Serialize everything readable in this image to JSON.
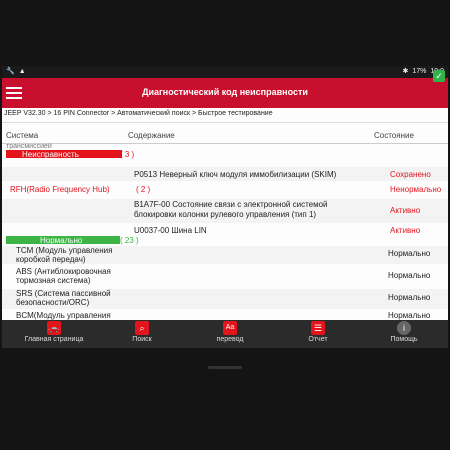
{
  "status_bar": {
    "bt": "✱",
    "battery": "17%",
    "time": "19:0"
  },
  "app": {
    "title": "Диагностический код неисправности"
  },
  "breadcrumb": "JEEP V32.30 > 16 PIN Connector > Автоматический поиск > Быстрое тестирование",
  "columns": {
    "system": "Система",
    "content": "Содержание",
    "status": "Состояние"
  },
  "cut_row": "трансмиссией",
  "fault_section": {
    "label": "Неисправность",
    "count": "( 3 )"
  },
  "faults": [
    {
      "content": "P0513 Неверный ключ модуля иммобилизации (SKIM)",
      "status": "Сохранено"
    },
    {
      "system": "RFH(Radio Frequency Hub)",
      "count": "( 2 )",
      "status": "Ненормально"
    },
    {
      "content": "B1A7F-00 Состояние связи с электронной системой блокировки колонки рулевого управления (тип 1)",
      "status": "Активно"
    },
    {
      "content": "U0037-00 Шина LIN",
      "status": "Активно"
    }
  ],
  "normal_section": {
    "label": "Нормально",
    "count": "( 23 )"
  },
  "normal_rows": [
    {
      "system": "TCM (Модуль управления коробкой передач)",
      "status": "Нормально"
    },
    {
      "system": "ABS (Антиблокировочная тормозная система)",
      "status": "Нормально"
    },
    {
      "system": "SRS (Система пассивной безопасности/ORC)",
      "status": "Нормально"
    },
    {
      "system": "BCM(Модуль управления",
      "status": "Нормально"
    }
  ],
  "nav": [
    {
      "label": "Главная страница",
      "icon": "car-icon",
      "color": "#e3141c"
    },
    {
      "label": "Поиск",
      "icon": "search-icon",
      "color": "#e3141c"
    },
    {
      "label": "перевод",
      "icon": "translate-icon",
      "color": "#e3141c"
    },
    {
      "label": "Отчет",
      "icon": "report-icon",
      "color": "#e3141c"
    },
    {
      "label": "Помощь",
      "icon": "help-icon",
      "color": "#999999"
    }
  ]
}
